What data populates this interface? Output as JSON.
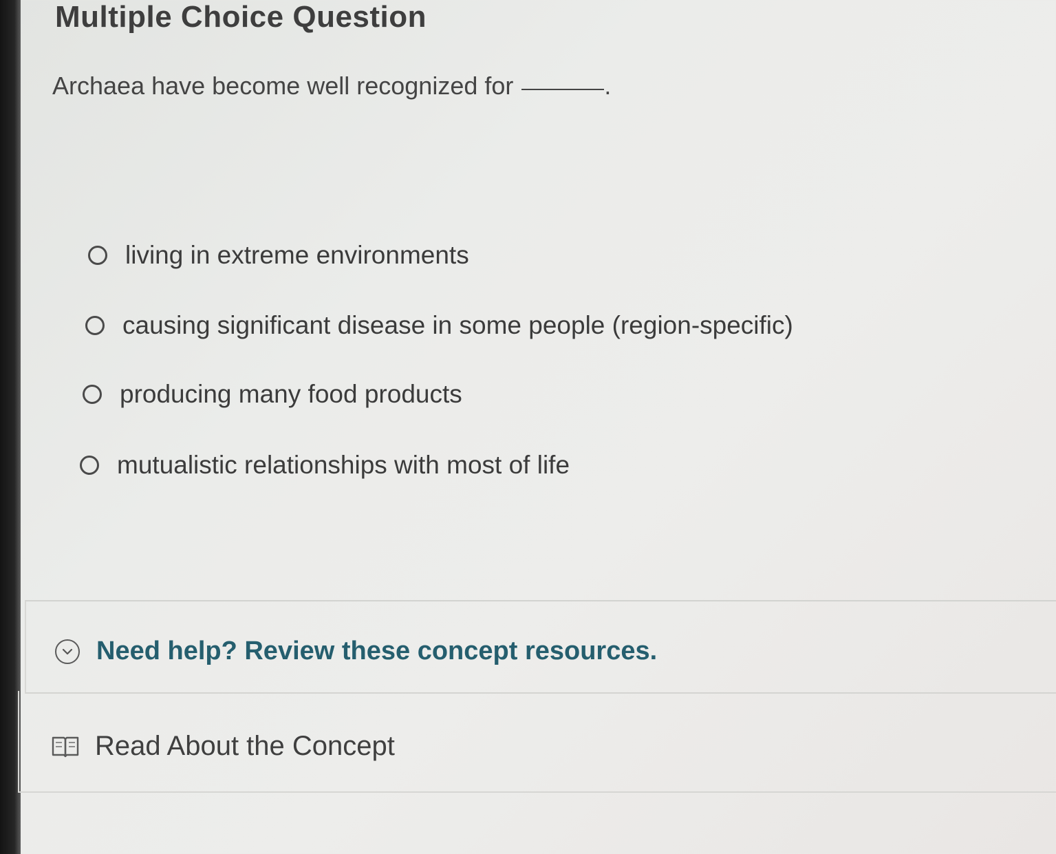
{
  "question": {
    "title": "Multiple Choice Question",
    "prompt": "Archaea have become well recognized for",
    "prompt_end": "."
  },
  "options": [
    {
      "label": "living in extreme environments",
      "selected": false
    },
    {
      "label": "causing significant disease in some people (region-specific)",
      "selected": false
    },
    {
      "label": "producing many food products",
      "selected": false
    },
    {
      "label": "mutualistic relationships with most of life",
      "selected": false
    }
  ],
  "help": {
    "toggle_label": "Need help? Review these concept resources.",
    "toggle_icon": "chevron-down-circle-icon",
    "resource_label": "Read About the Concept",
    "resource_icon": "book-icon"
  },
  "colors": {
    "help_text": "#255e6e",
    "background": "#ebecea"
  }
}
